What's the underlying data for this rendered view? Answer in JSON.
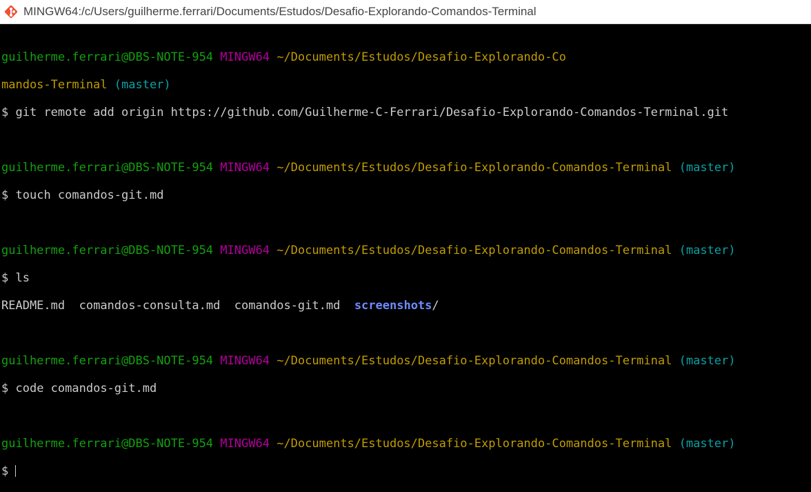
{
  "window": {
    "title": "MINGW64:/c/Users/guilherme.ferrari/Documents/Estudos/Desafio-Explorando-Comandos-Terminal",
    "icon": "git-bash-icon"
  },
  "colors": {
    "user": "#13a10e",
    "system": "#b4009e",
    "path": "#c19c00",
    "branch": "#0aa1a6",
    "text": "#cccccc",
    "directory": "#6e8cff",
    "background": "#000000"
  },
  "prompt": {
    "user_host": "guilherme.ferrari@DBS-NOTE-954",
    "system": "MINGW64",
    "path": "~/Documents/Estudos/Desafio-Explorando-Comandos-Terminal",
    "path_wrap_line1": "~/Documents/Estudos/Desafio-Explorando-Co",
    "path_wrap_line2": "mandos-Terminal",
    "branch": "(master)",
    "symbol": "$"
  },
  "commands": [
    "git remote add origin https://github.com/Guilherme-C-Ferrari/Desafio-Explorando-Comandos-Terminal.git",
    "touch comandos-git.md",
    "ls",
    "code comandos-git.md"
  ],
  "ls_output": {
    "files": [
      "README.md",
      "comandos-consulta.md",
      "comandos-git.md"
    ],
    "directory": "screenshots",
    "dir_suffix": "/"
  }
}
